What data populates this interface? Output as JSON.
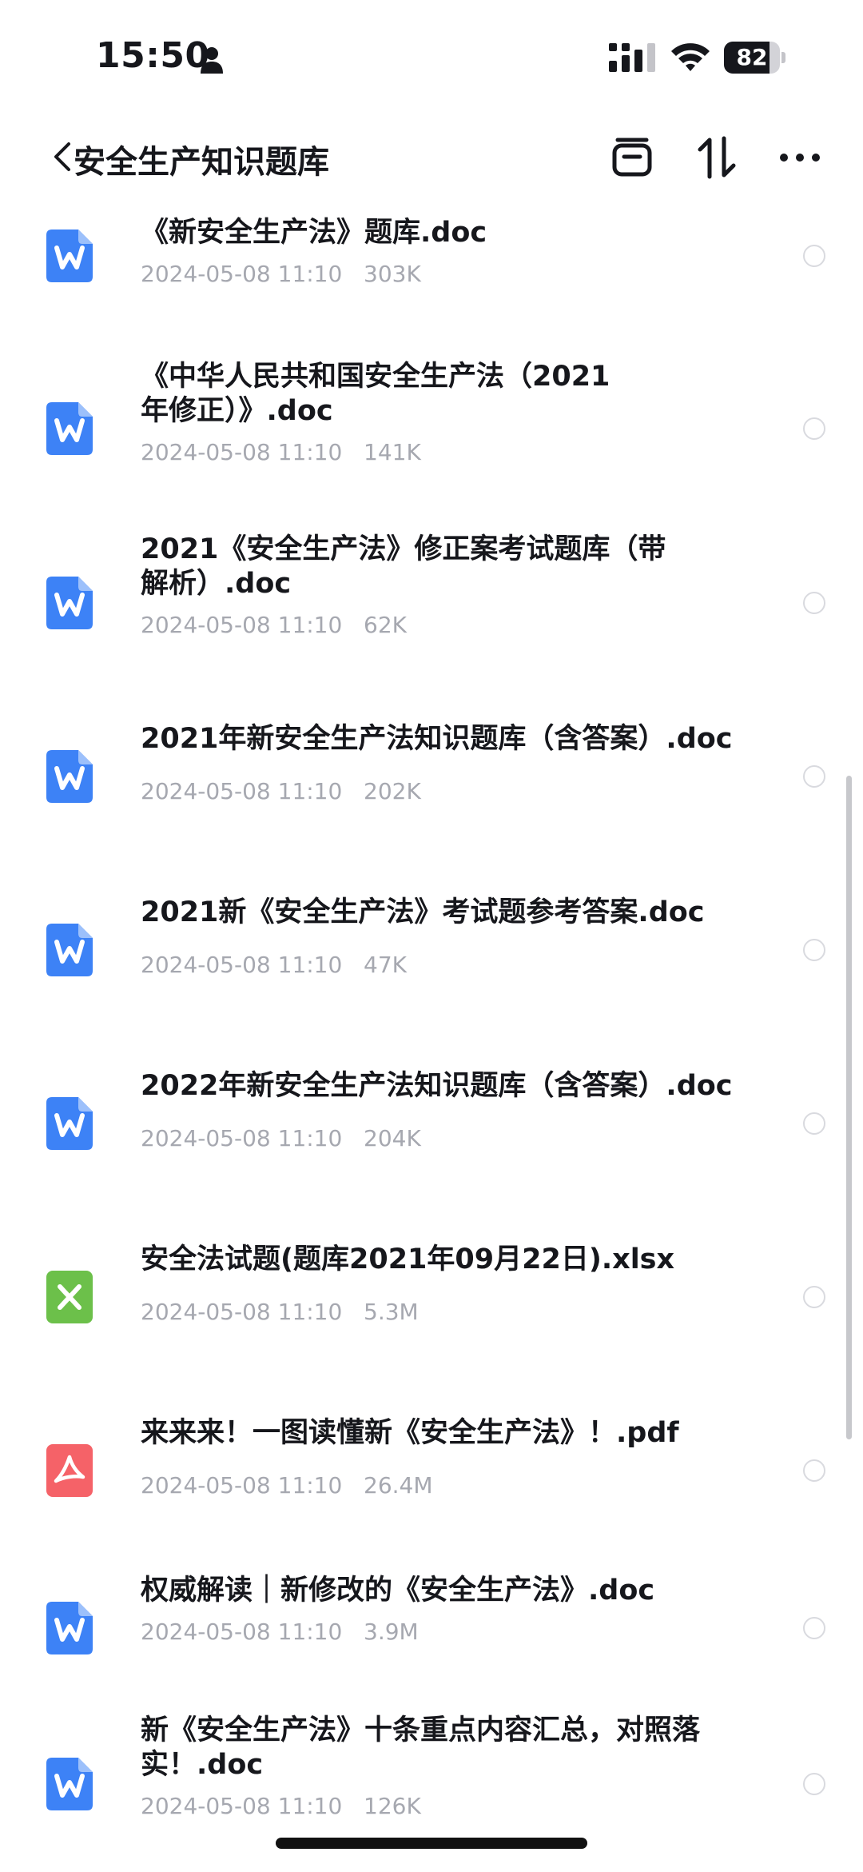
{
  "status_bar": {
    "time": "15:50",
    "battery_level": "82",
    "battery_fraction": 0.82,
    "icons": [
      "person-icon",
      "cellular-signal-icon",
      "wifi-icon",
      "battery-icon"
    ]
  },
  "header": {
    "title": "安全生产知识题库",
    "icons": [
      "back-chevron-icon",
      "archive-icon",
      "sort-icon",
      "more-icon"
    ]
  },
  "files": [
    {
      "name": "《新安全生产法》题库.doc",
      "date": "2024-05-08 11:10",
      "size": "303K",
      "type": "word"
    },
    {
      "name": "《中华人民共和国安全生产法（2021年修正）》.doc",
      "date": "2024-05-08 11:10",
      "size": "141K",
      "type": "word"
    },
    {
      "name": "2021《安全生产法》修正案考试题库（带解析）.doc",
      "date": "2024-05-08 11:10",
      "size": "62K",
      "type": "word"
    },
    {
      "name": "2021年新安全生产法知识题库（含答案）.doc",
      "date": "2024-05-08 11:10",
      "size": "202K",
      "type": "word"
    },
    {
      "name": "2021新《安全生产法》考试题参考答案.doc",
      "date": "2024-05-08 11:10",
      "size": "47K",
      "type": "word"
    },
    {
      "name": "2022年新安全生产法知识题库（含答案）.doc",
      "date": "2024-05-08 11:10",
      "size": "204K",
      "type": "word"
    },
    {
      "name": "安全法试题(题库2021年09月22日).xlsx",
      "date": "2024-05-08 11:10",
      "size": "5.3M",
      "type": "excel"
    },
    {
      "name": "来来来！一图读懂新《安全生产法》！.pdf",
      "date": "2024-05-08 11:10",
      "size": "26.4M",
      "type": "pdf"
    },
    {
      "name": "权威解读｜新修改的《安全生产法》.doc",
      "date": "2024-05-08 11:10",
      "size": "3.9M",
      "type": "word"
    },
    {
      "name": "新《安全生产法》十条重点内容汇总，对照落实！.doc",
      "date": "2024-05-08 11:10",
      "size": "126K",
      "type": "word"
    }
  ],
  "colors": {
    "word": "#3d82f6",
    "excel": "#6cc04a",
    "pdf": "#f56268",
    "text_primary": "#16171c",
    "text_secondary": "#a6a8b0"
  }
}
